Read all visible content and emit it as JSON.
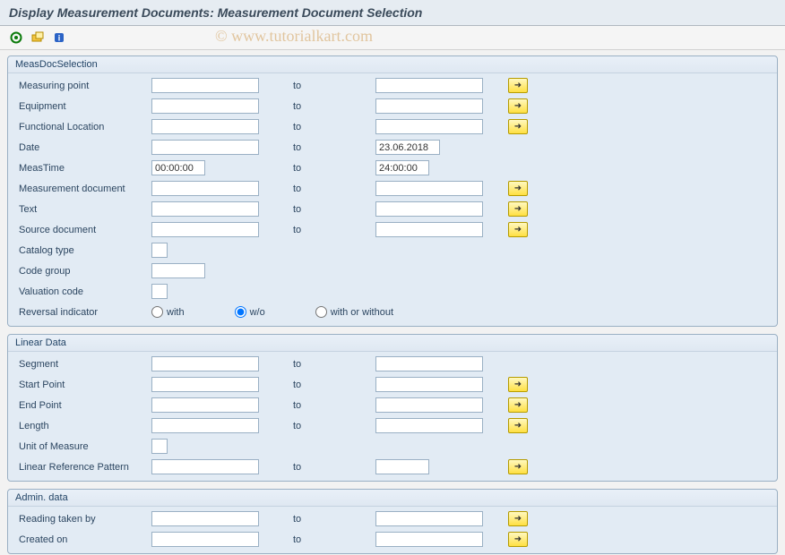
{
  "title": "Display Measurement Documents: Measurement Document Selection",
  "watermark": "© www.tutorialkart.com",
  "to_label": "to",
  "group1": {
    "title": "MeasDocSelection",
    "fields": {
      "measuring_point": {
        "label": "Measuring point",
        "from": "",
        "to": ""
      },
      "equipment": {
        "label": "Equipment",
        "from": "",
        "to": ""
      },
      "func_loc": {
        "label": "Functional Location",
        "from": "",
        "to": ""
      },
      "date": {
        "label": "Date",
        "from": "",
        "to": "23.06.2018"
      },
      "meas_time": {
        "label": "MeasTime",
        "from": "00:00:00",
        "to": "24:00:00"
      },
      "meas_doc": {
        "label": "Measurement document",
        "from": "",
        "to": ""
      },
      "text": {
        "label": "Text",
        "from": "",
        "to": ""
      },
      "source_doc": {
        "label": "Source document",
        "from": "",
        "to": ""
      },
      "catalog_type": {
        "label": "Catalog type",
        "value": ""
      },
      "code_group": {
        "label": "Code group",
        "value": ""
      },
      "valuation_code": {
        "label": "Valuation code",
        "value": ""
      },
      "reversal": {
        "label": "Reversal indicator",
        "options": {
          "with": "with",
          "wo": "w/o",
          "both": "with or without"
        },
        "selected": "wo"
      }
    }
  },
  "group2": {
    "title": "Linear Data",
    "fields": {
      "segment": {
        "label": "Segment",
        "from": "",
        "to": ""
      },
      "start_point": {
        "label": "Start Point",
        "from": "",
        "to": ""
      },
      "end_point": {
        "label": "End Point",
        "from": "",
        "to": ""
      },
      "length": {
        "label": "Length",
        "from": "",
        "to": ""
      },
      "uom": {
        "label": "Unit of Measure",
        "value": ""
      },
      "lrp": {
        "label": "Linear Reference Pattern",
        "from": "",
        "to": ""
      }
    }
  },
  "group3": {
    "title": "Admin. data",
    "fields": {
      "reading_taken_by": {
        "label": "Reading taken by",
        "from": "",
        "to": ""
      },
      "created_on": {
        "label": "Created on",
        "from": "",
        "to": ""
      }
    }
  }
}
